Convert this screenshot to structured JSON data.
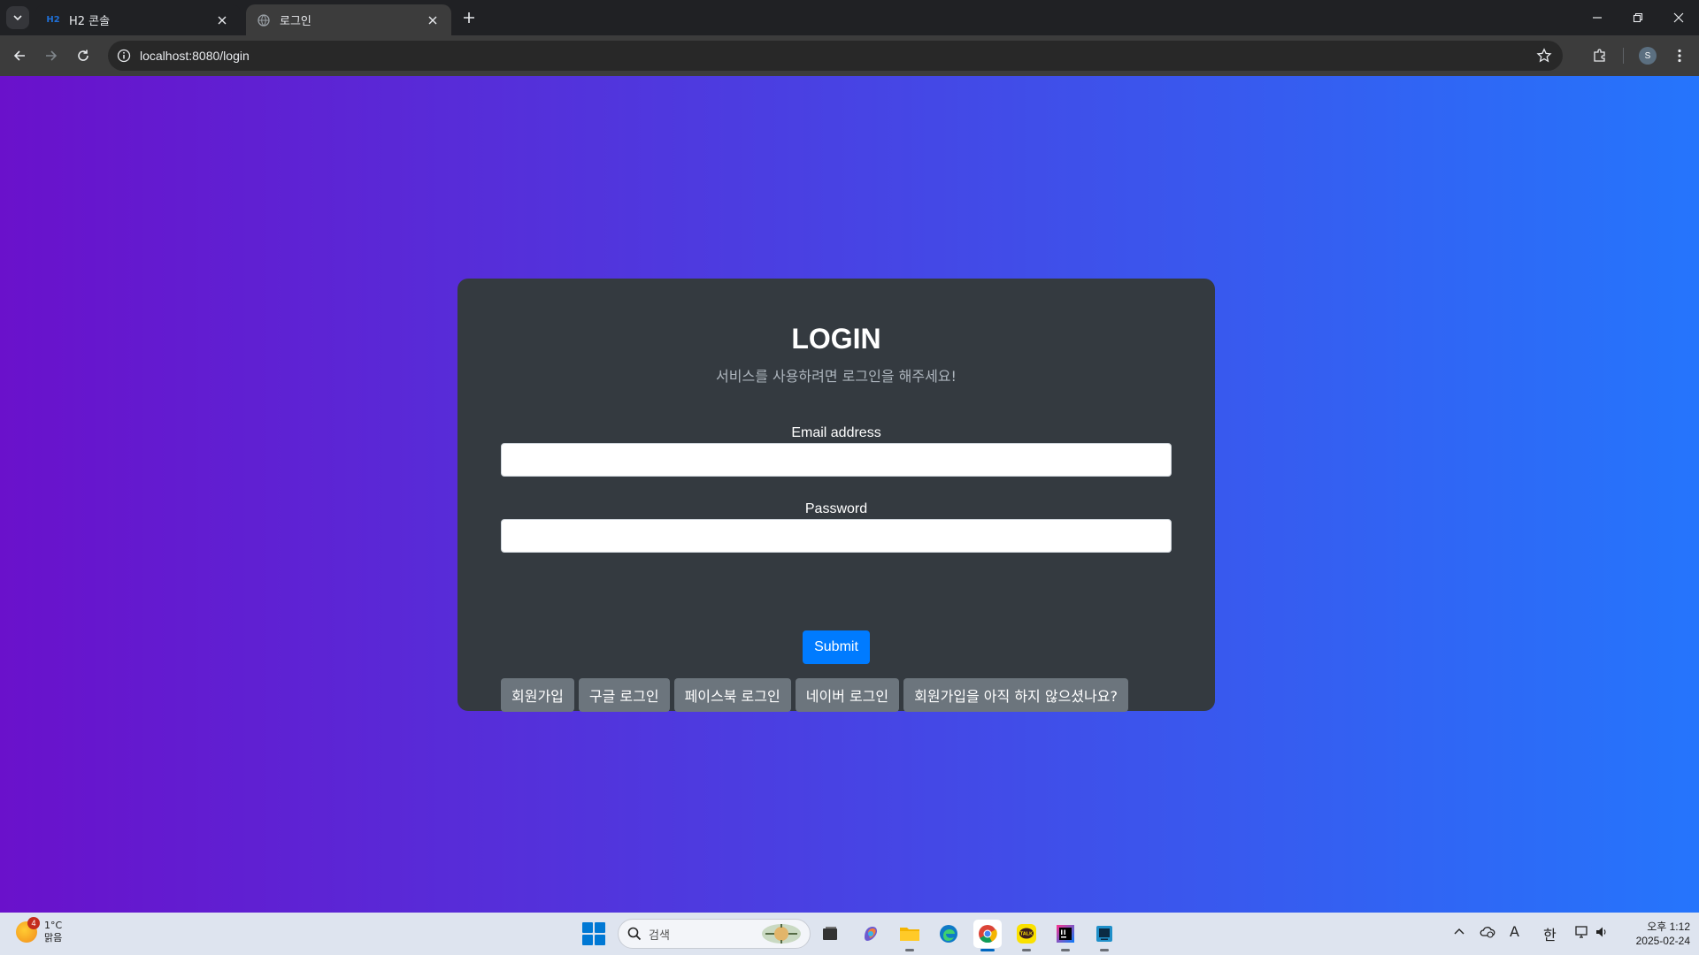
{
  "browser": {
    "tabs": [
      {
        "title": "H2 콘솔",
        "favicon_text": "H2",
        "active": false
      },
      {
        "title": "로그인",
        "active": true
      }
    ],
    "url": "localhost:8080/login",
    "profile_initial": "S"
  },
  "page": {
    "gradient": [
      "#6a11cb",
      "#2575fc"
    ],
    "title": "LOGIN",
    "subtitle": "서비스를 사용하려면 로그인을 해주세요!",
    "email": {
      "label": "Email address",
      "value": ""
    },
    "password": {
      "label": "Password",
      "value": ""
    },
    "submit_label": "Submit",
    "actions": [
      {
        "label": "회원가입"
      },
      {
        "label": "구글 로그인"
      },
      {
        "label": "페이스북 로그인"
      },
      {
        "label": "네이버 로그인"
      },
      {
        "label": "회원가입을 아직 하지 않으셨나요?"
      }
    ],
    "accent_color": "#007bff"
  },
  "taskbar": {
    "weather": {
      "temp": "1°C",
      "condition": "맑음",
      "badge": "4"
    },
    "search_placeholder": "검색",
    "ime_lang": "한",
    "ime_mode": "A",
    "clock": {
      "time": "오후 1:12",
      "date": "2025-02-24"
    },
    "kakao_label": "TALK"
  }
}
